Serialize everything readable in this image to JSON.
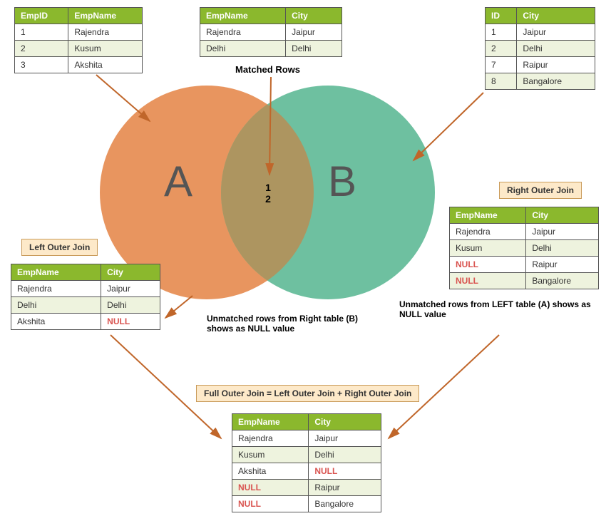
{
  "tableA": {
    "headers": [
      "EmpID",
      "EmpName"
    ],
    "rows": [
      [
        "1",
        "Rajendra"
      ],
      [
        "2",
        "Kusum"
      ],
      [
        "3",
        "Akshita"
      ]
    ]
  },
  "tableMatched": {
    "headers": [
      "EmpName",
      "City"
    ],
    "rows": [
      [
        "Rajendra",
        "Jaipur"
      ],
      [
        "Delhi",
        "Delhi"
      ]
    ]
  },
  "tableB": {
    "headers": [
      "ID",
      "City"
    ],
    "rows": [
      [
        "1",
        "Jaipur"
      ],
      [
        "2",
        "Delhi"
      ],
      [
        "7",
        "Raipur"
      ],
      [
        "8",
        "Bangalore"
      ]
    ]
  },
  "leftJoin": {
    "label": "Left Outer Join",
    "headers": [
      "EmpName",
      "City"
    ],
    "rows": [
      {
        "c": [
          "Rajendra",
          "Jaipur"
        ],
        "null": [
          false,
          false
        ]
      },
      {
        "c": [
          "Delhi",
          "Delhi"
        ],
        "null": [
          false,
          false
        ]
      },
      {
        "c": [
          "Akshita",
          "NULL"
        ],
        "null": [
          false,
          true
        ]
      }
    ]
  },
  "rightJoin": {
    "label": "Right Outer Join",
    "headers": [
      "EmpName",
      "City"
    ],
    "rows": [
      {
        "c": [
          "Rajendra",
          "Jaipur"
        ],
        "null": [
          false,
          false
        ]
      },
      {
        "c": [
          "Kusum",
          "Delhi"
        ],
        "null": [
          false,
          false
        ]
      },
      {
        "c": [
          "NULL",
          "Raipur"
        ],
        "null": [
          true,
          false
        ]
      },
      {
        "c": [
          "NULL",
          "Bangalore"
        ],
        "null": [
          true,
          false
        ]
      }
    ]
  },
  "fullJoin": {
    "label": "Full Outer Join = Left Outer Join + Right Outer Join",
    "headers": [
      "EmpName",
      "City"
    ],
    "rows": [
      {
        "c": [
          "Rajendra",
          "Jaipur"
        ],
        "null": [
          false,
          false
        ]
      },
      {
        "c": [
          "Kusum",
          "Delhi"
        ],
        "null": [
          false,
          false
        ]
      },
      {
        "c": [
          "Akshita",
          "NULL"
        ],
        "null": [
          false,
          true
        ]
      },
      {
        "c": [
          "NULL",
          "Raipur"
        ],
        "null": [
          true,
          false
        ]
      },
      {
        "c": [
          "NULL",
          "Bangalore"
        ],
        "null": [
          true,
          false
        ]
      }
    ]
  },
  "captions": {
    "matched": "Matched Rows",
    "leftNote": "Unmatched rows from Right table (B) shows as NULL value",
    "rightNote": "Unmatched rows from LEFT table (A) shows as NULL value"
  },
  "venn": {
    "labelA": "A",
    "labelB": "B",
    "intersection": [
      "1",
      "2"
    ]
  }
}
